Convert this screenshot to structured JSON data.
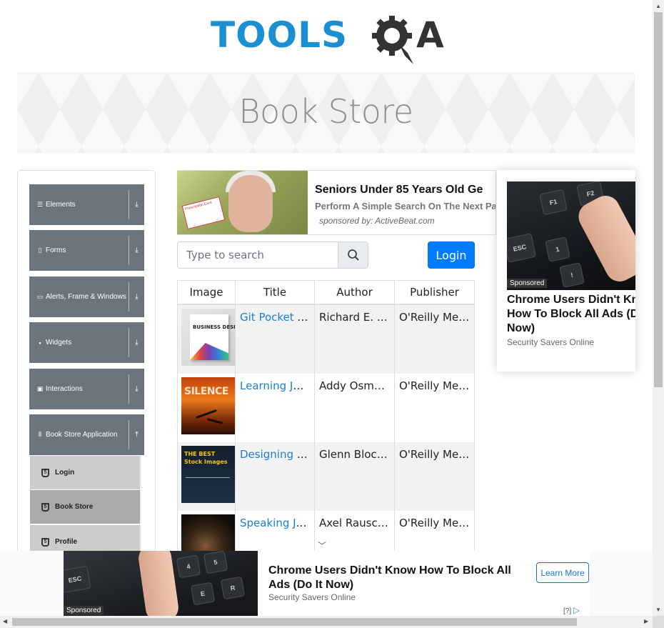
{
  "logo": {
    "text_part1": "TOOLS",
    "text_part2": "A"
  },
  "banner": {
    "title": "Book Store"
  },
  "sidebar": {
    "groups": [
      {
        "label": "Elements",
        "icon": "list-icon",
        "arrow": "⤓"
      },
      {
        "label": "Forms",
        "icon": "document-icon",
        "arrow": "⤓"
      },
      {
        "label": "Alerts, Frame & Windows",
        "icon": "window-icon",
        "arrow": "⤓"
      },
      {
        "label": "Widgets",
        "icon": "grid-icon",
        "arrow": "⤓"
      },
      {
        "label": "Interactions",
        "icon": "square-icon",
        "arrow": "⤓"
      },
      {
        "label": "Book Store Application",
        "icon": "books-icon",
        "arrow": "⤒"
      }
    ],
    "book_store_items": [
      {
        "label": "Login",
        "active": false
      },
      {
        "label": "Book Store",
        "active": true
      },
      {
        "label": "Profile",
        "active": false
      }
    ]
  },
  "top_ad": {
    "headline": "Seniors Under 85 Years Old Ge",
    "subline": "Perform A Simple Search On The Next Pa",
    "sponsor": "sponsored by: ActiveBeat.com",
    "card_text": "Prescription Card"
  },
  "search": {
    "placeholder": "Type to search",
    "value": ""
  },
  "login_button": "Login",
  "table": {
    "headers": [
      "Image",
      "Title",
      "Author",
      "Publisher"
    ],
    "rows": [
      {
        "title": "Git Pocket Guide",
        "author": "Richard E. Silverman",
        "publisher": "O'Reilly Media",
        "cover_text": "BUSINESS DESIGN"
      },
      {
        "title": "Learning JavaScript Design Patterns",
        "author": "Addy Osmani",
        "publisher": "O'Reilly Media",
        "cover_text": "SILENCE"
      },
      {
        "title": "Designing Evolvable Web APIs with ASP.NET",
        "author": "Glenn Block et al.",
        "publisher": "O'Reilly Media",
        "cover_text": "THE BEST Stock Images"
      },
      {
        "title": "Speaking JavaScript",
        "author": "Axel Rauschmayer",
        "publisher": "O'Reilly Media",
        "cover_text": ""
      }
    ]
  },
  "side_ad": {
    "sponsored": "Sponsored",
    "headline": "Chrome Users Didn't Know How To Block All Ads (Do It Now)",
    "source": "Security Savers Online"
  },
  "bottom_ad": {
    "sponsored": "Sponsored",
    "headline": "Chrome Users Didn't Know How To Block All Ads (Do It Now)",
    "source": "Security Savers Online",
    "cta": "Learn More",
    "adchoices": "[?]"
  },
  "colors": {
    "primary": "#007bff",
    "sidebar_header": "#6c757d",
    "link": "#1a7fd4",
    "logo_blue": "#1a8fd1",
    "logo_dark": "#333333"
  }
}
